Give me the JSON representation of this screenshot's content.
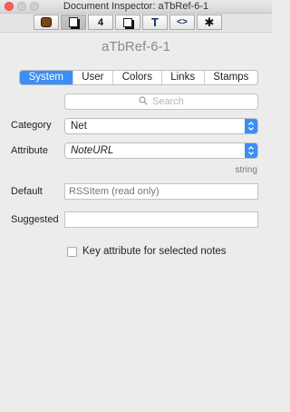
{
  "window": {
    "title": "Document Inspector: aTbRef-6-1"
  },
  "toolbar": {
    "buttons": [
      {
        "icon": "doc-properties-icon"
      },
      {
        "icon": "note-icon"
      },
      {
        "icon": "quick-stamp-icon",
        "glyph": "4"
      },
      {
        "icon": "shadow-icon"
      },
      {
        "icon": "text-icon",
        "glyph": "T"
      },
      {
        "icon": "action-code-icon",
        "glyph": "<>"
      },
      {
        "icon": "gear-icon",
        "glyph": "✱"
      }
    ]
  },
  "document_name": "aTbRef-6-1",
  "tabs": [
    "System",
    "User",
    "Colors",
    "Links",
    "Stamps"
  ],
  "active_tab": "System",
  "search": {
    "placeholder": "Search"
  },
  "category": {
    "label": "Category",
    "value": "Net"
  },
  "attribute": {
    "label": "Attribute",
    "value": "NoteURL",
    "type": "string"
  },
  "default": {
    "label": "Default",
    "placeholder": "RSSItem (read only)"
  },
  "suggested": {
    "label": "Suggested",
    "value": ""
  },
  "key_attribute": {
    "label": "Key attribute for selected notes",
    "checked": false
  },
  "colors": {
    "accent": "#3b8ef5"
  }
}
